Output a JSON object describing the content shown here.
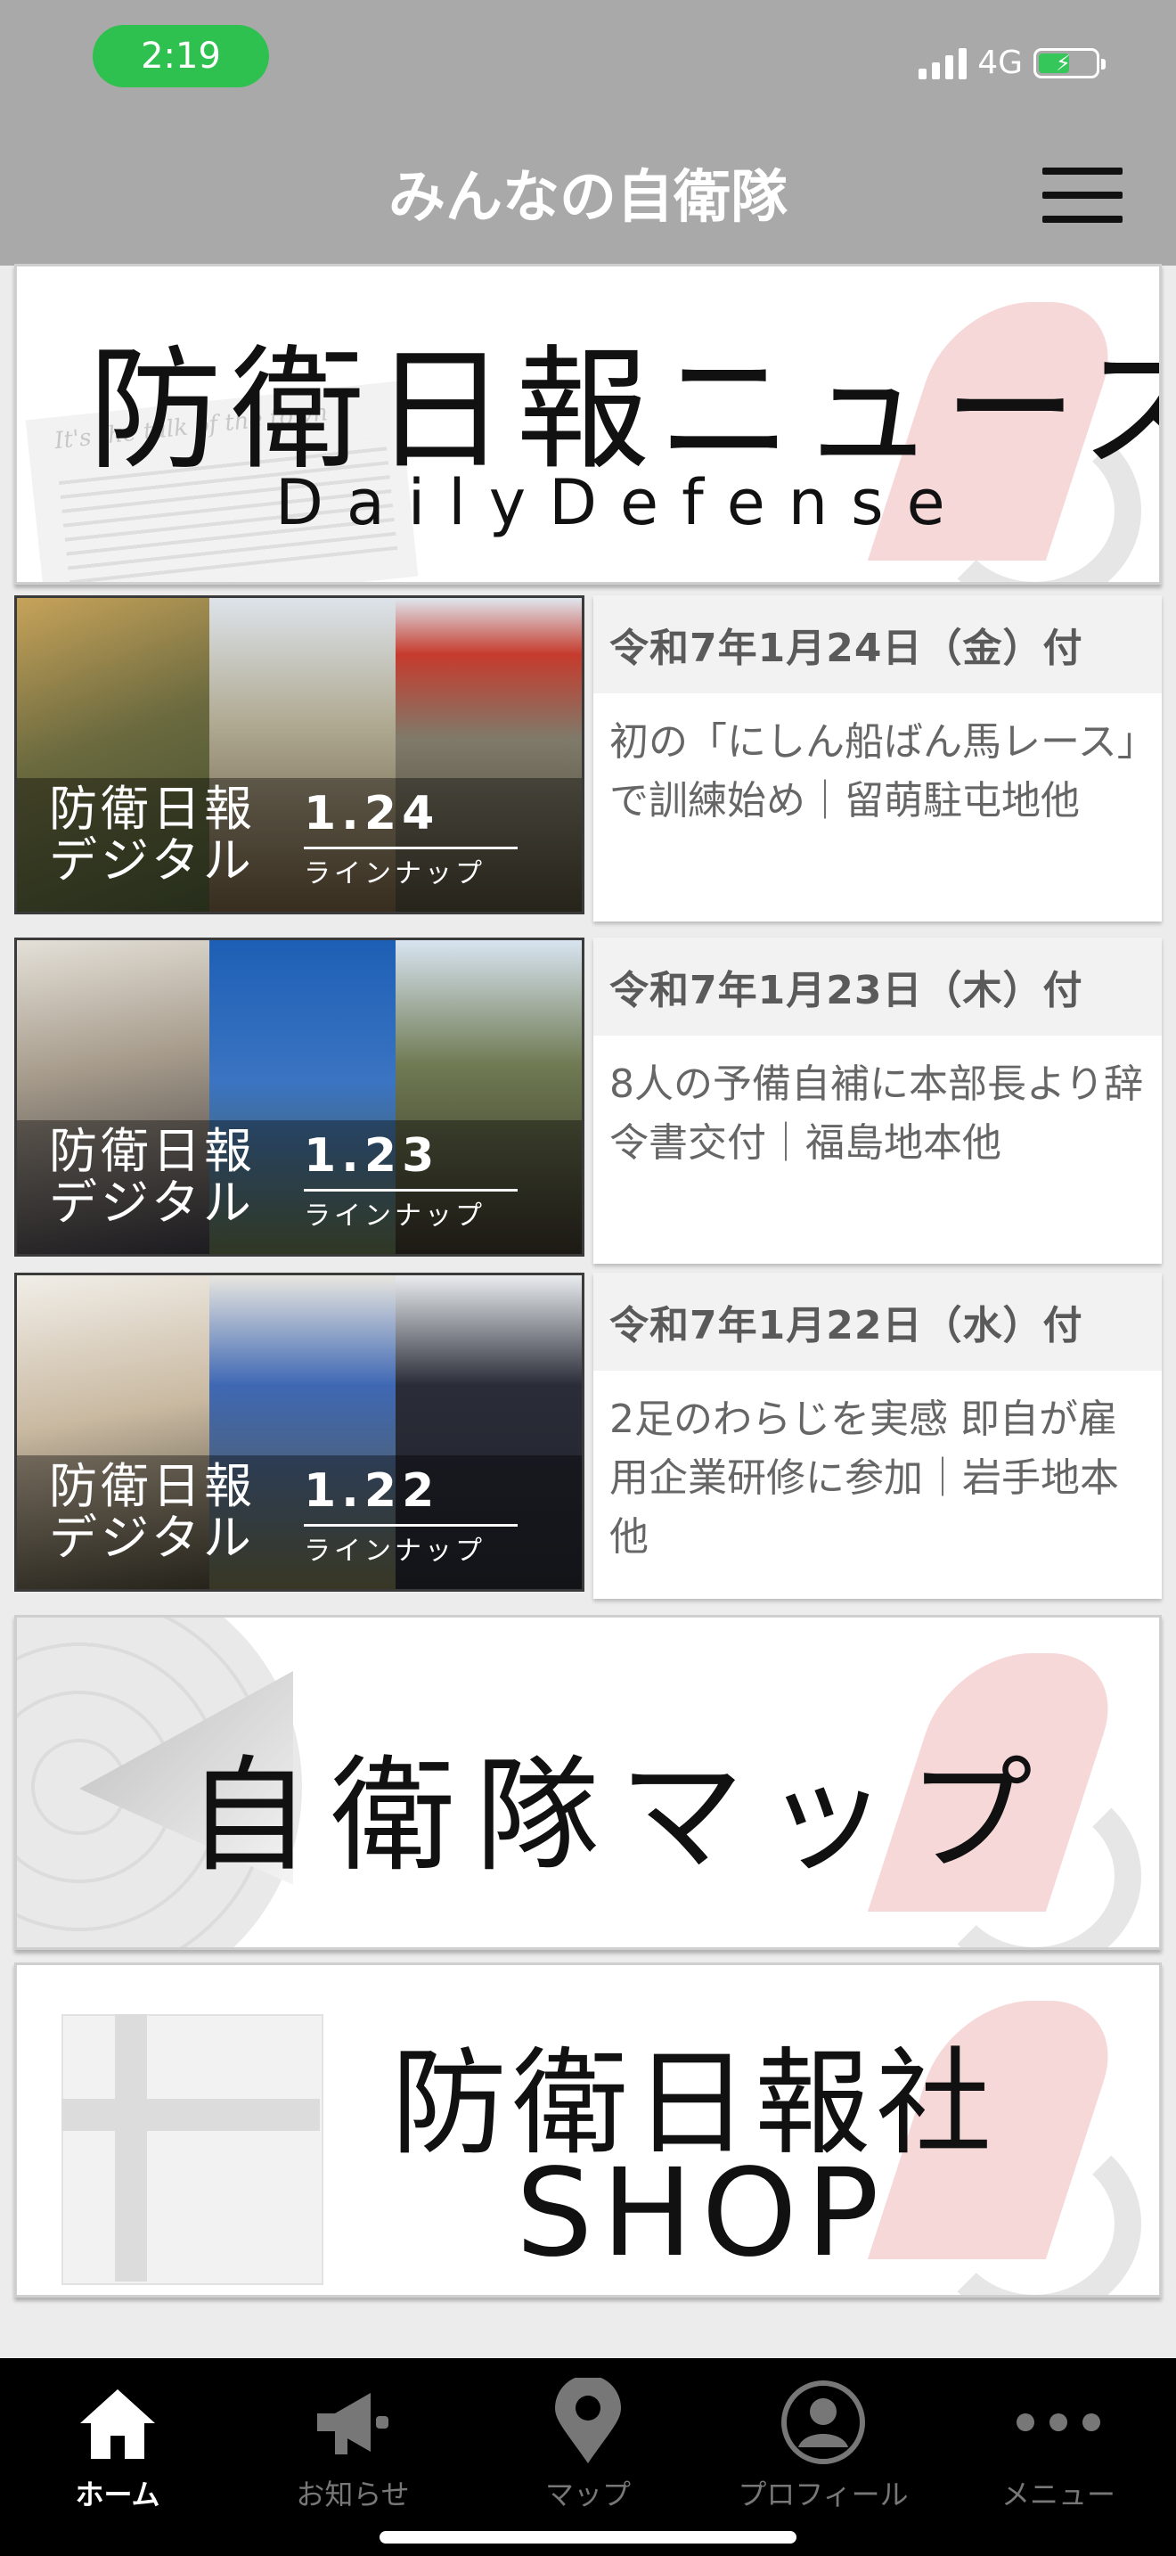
{
  "status": {
    "time": "2:19",
    "network": "4G"
  },
  "header": {
    "title": "みんなの自衛隊"
  },
  "news_banner": {
    "title": "防衛日報ニュース",
    "subtitle": "DailyDefense",
    "paper_text": "It's the talk of the town"
  },
  "articles": [
    {
      "thumb_label_1": "防衛日報",
      "thumb_label_2": "デジタル",
      "thumb_date": "1.24",
      "thumb_lineup": "ラインナップ",
      "date": "令和7年1月24日（金）付",
      "headline": "初の「にしん船ばん馬レース」で訓練始め｜留萌駐屯地他"
    },
    {
      "thumb_label_1": "防衛日報",
      "thumb_label_2": "デジタル",
      "thumb_date": "1.23",
      "thumb_lineup": "ラインナップ",
      "date": "令和7年1月23日（木）付",
      "headline": "8人の予備自補に本部長より辞令書交付｜福島地本他"
    },
    {
      "thumb_label_1": "防衛日報",
      "thumb_label_2": "デジタル",
      "thumb_date": "1.22",
      "thumb_lineup": "ラインナップ",
      "date": "令和7年1月22日（水）付",
      "headline": "2足のわらじを実感 即自が雇用企業研修に参加｜岩手地本他"
    }
  ],
  "map_banner": {
    "title": "自衛隊マップ"
  },
  "shop_banner": {
    "title": "防衛日報社",
    "subtitle": "SHOP"
  },
  "tabs": [
    {
      "label": "ホーム",
      "icon": "home-icon",
      "active": true
    },
    {
      "label": "お知らせ",
      "icon": "megaphone-icon"
    },
    {
      "label": "マップ",
      "icon": "map-pin-icon"
    },
    {
      "label": "プロフィール",
      "icon": "profile-icon"
    },
    {
      "label": "メニュー",
      "icon": "more-icon"
    }
  ],
  "colors": {
    "header_bg": "#a9a9a9",
    "time_pill": "#2fc14f",
    "tabbar_bg": "#000000",
    "date_bar_bg": "#f2f2f2"
  }
}
